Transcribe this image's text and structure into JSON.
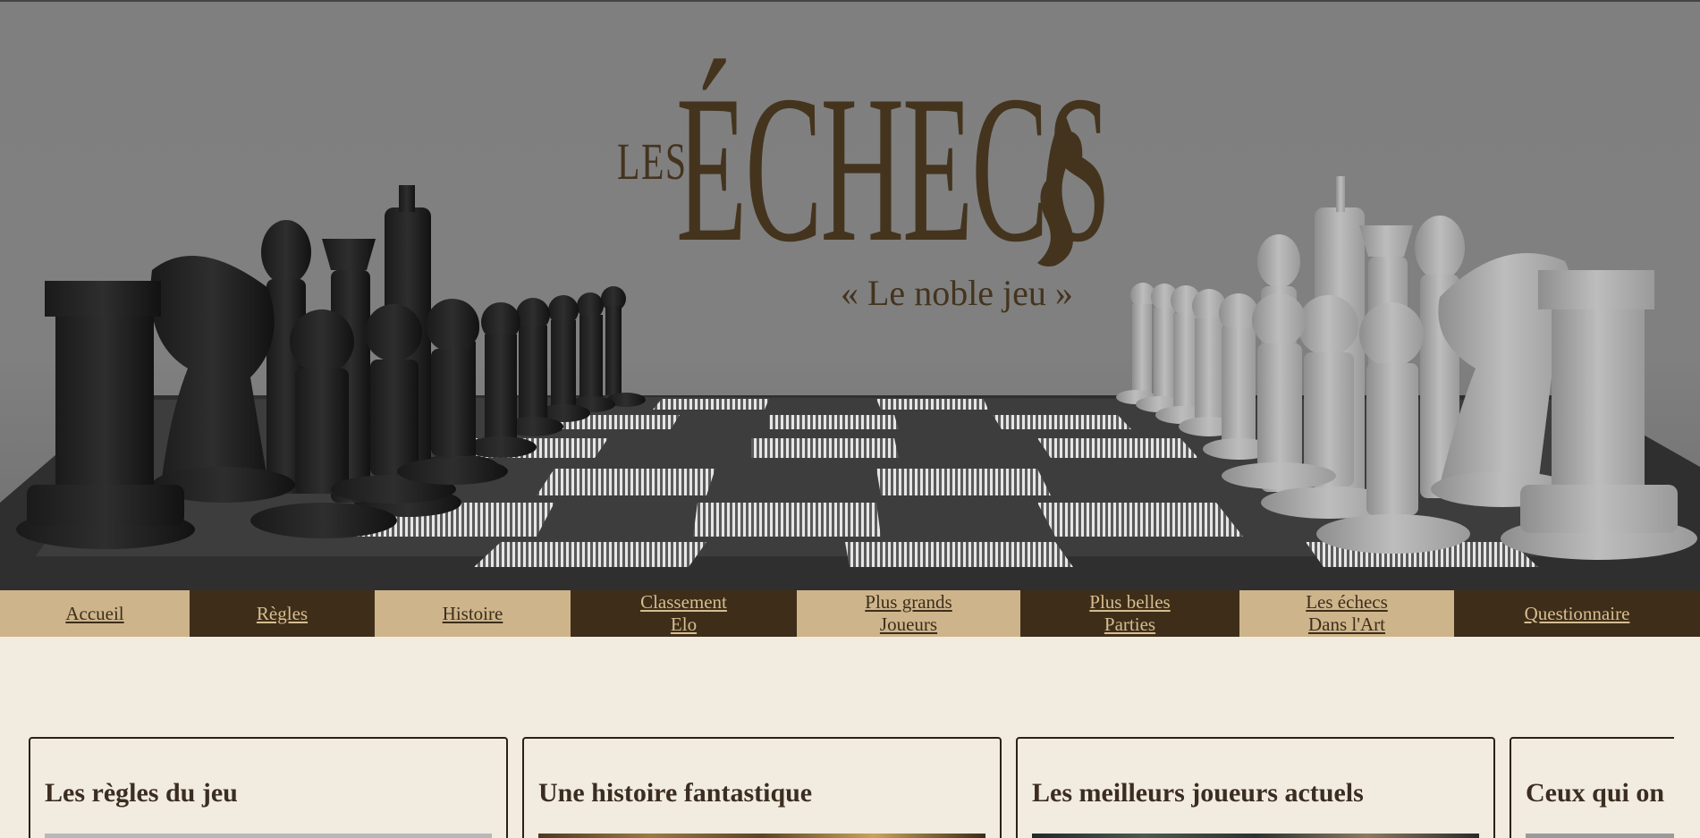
{
  "hero": {
    "logo_prefix": "LES",
    "logo_title": "ÉCHECS",
    "logo_subtitle": "« Le noble jeu »"
  },
  "nav": {
    "items": [
      {
        "line1": "Accueil",
        "line2": ""
      },
      {
        "line1": "Règles",
        "line2": ""
      },
      {
        "line1": "Histoire",
        "line2": ""
      },
      {
        "line1": "Classement",
        "line2": "Elo"
      },
      {
        "line1": "Plus grands",
        "line2": "Joueurs"
      },
      {
        "line1": "Plus belles",
        "line2": "Parties"
      },
      {
        "line1": "Les échecs",
        "line2": "Dans l'Art"
      },
      {
        "line1": "Questionnaire",
        "line2": ""
      }
    ]
  },
  "cards": [
    {
      "title": "Les règles du jeu"
    },
    {
      "title": "Une histoire fantastique"
    },
    {
      "title": "Les meilleurs joueurs actuels"
    },
    {
      "title": "Ceux qui on"
    }
  ],
  "colors": {
    "brand_brown": "#44341e",
    "nav_light": "#cdb48b",
    "nav_dark": "#3e2e19",
    "page_bg": "#f2ebe0"
  }
}
